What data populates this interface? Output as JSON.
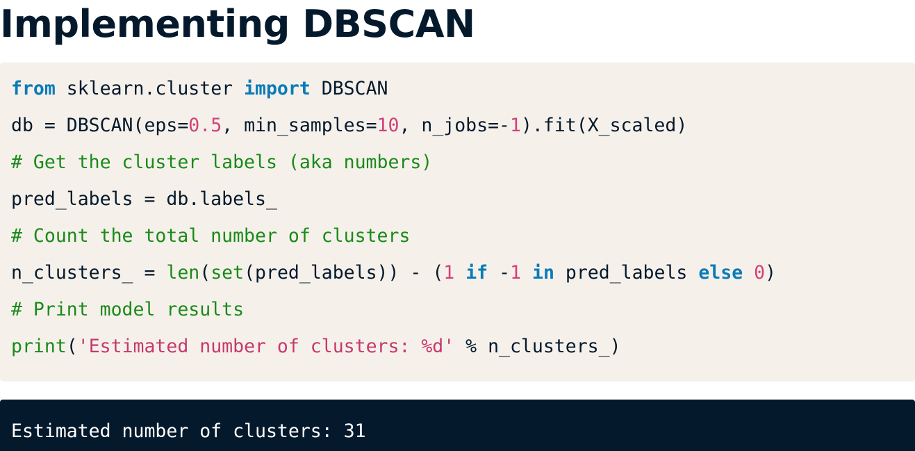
{
  "heading": "Implementing DBSCAN",
  "code": {
    "line1": {
      "kw_from": "from",
      "module": " sklearn.cluster ",
      "kw_import": "import",
      "name": " DBSCAN"
    },
    "line2": {
      "p1": "db = DBSCAN(eps=",
      "eps": "0.5",
      "p2": ", min_samples=",
      "min_samples": "10",
      "p3": ", n_jobs=-",
      "n_jobs": "1",
      "p4": ").fit(X_scaled)"
    },
    "line3": {
      "comment": "# Get the cluster labels (aka numbers)"
    },
    "line4": {
      "text": "pred_labels = db.labels_"
    },
    "line5": {
      "comment": "# Count the total number of clusters"
    },
    "line6": {
      "p1": "n_clusters_ = ",
      "len": "len",
      "p2": "(",
      "set": "set",
      "p3": "(pred_labels)) - (",
      "n1": "1",
      "sp1": " ",
      "kw_if": "if",
      "p4": " -",
      "n2": "1",
      "sp2": " ",
      "kw_in": "in",
      "p5": " pred_labels ",
      "kw_else": "else",
      "sp3": " ",
      "n3": "0",
      "p6": ")"
    },
    "line7": {
      "comment": "# Print model results"
    },
    "line8": {
      "print": "print",
      "p1": "(",
      "str": "'Estimated number of clusters: %d'",
      "p2": " % n_clusters_)"
    }
  },
  "output": {
    "text": "Estimated number of clusters: 31"
  },
  "colors": {
    "heading": "#05192d",
    "code_background": "#f5f1ea",
    "keyword": "#0a7bb8",
    "number": "#d2417a",
    "comment": "#1a8a1a",
    "string": "#c7386d",
    "output_background": "#05192d",
    "output_text": "#ffffff"
  }
}
